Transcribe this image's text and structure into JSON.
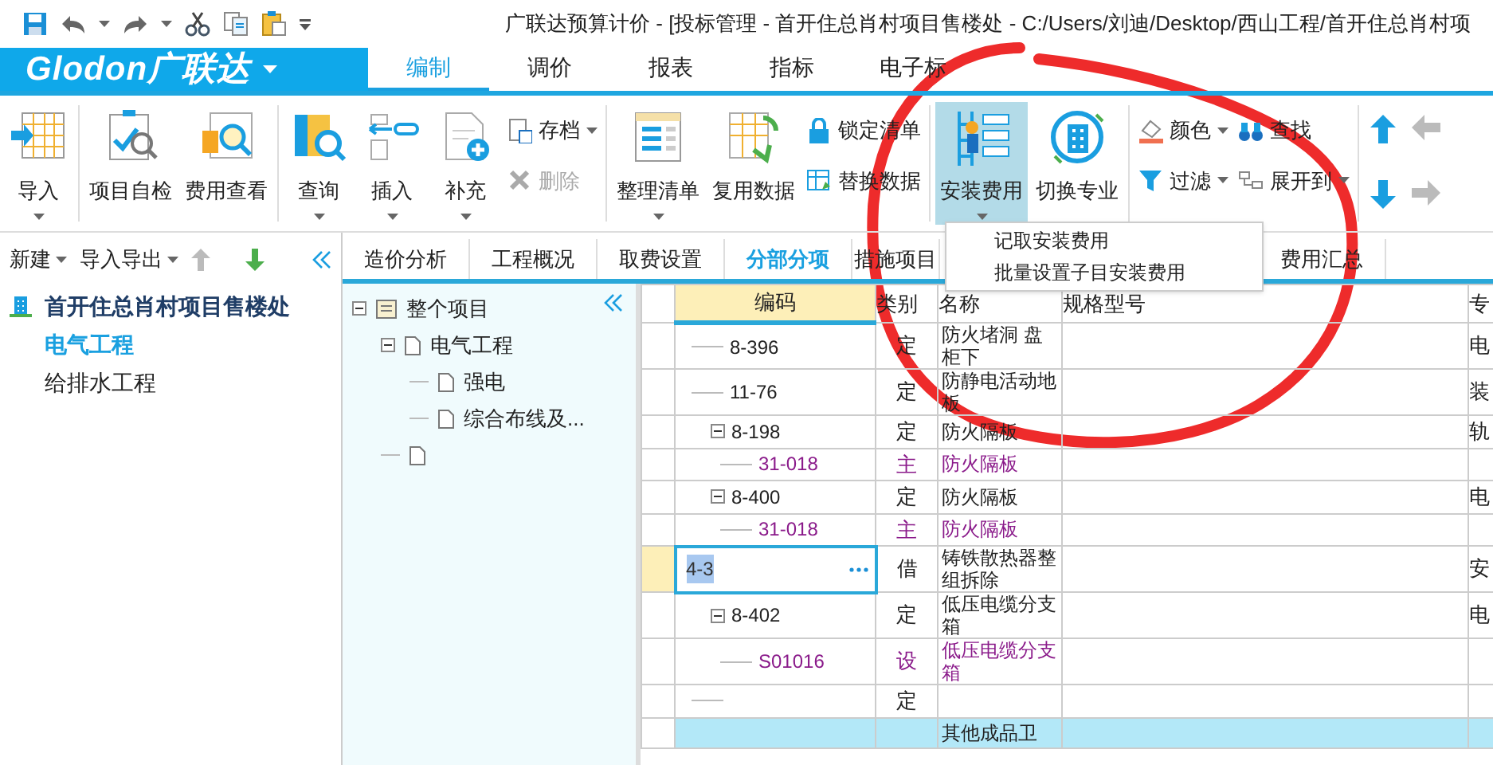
{
  "window": {
    "title": "广联达预算计价 - [投标管理 - 首开住总肖村项目售楼处 - C:/Users/刘迪/Desktop/西山工程/首开住总肖村项"
  },
  "logo": "Glodon广联达",
  "menu_tabs": [
    {
      "label": "编制",
      "selected": true
    },
    {
      "label": "调价",
      "selected": false
    },
    {
      "label": "报表",
      "selected": false
    },
    {
      "label": "指标",
      "selected": false
    },
    {
      "label": "电子标",
      "selected": false
    }
  ],
  "ribbon": [
    [
      {
        "kind": "large",
        "label": "导入",
        "dropdown": true,
        "pressed": false
      }
    ],
    [
      {
        "kind": "large",
        "label": "项目自检",
        "dropdown": false,
        "pressed": false
      },
      {
        "kind": "large",
        "label": "费用查看",
        "dropdown": false,
        "pressed": false
      }
    ],
    [
      {
        "kind": "large",
        "label": "查询",
        "dropdown": true,
        "pressed": false
      },
      {
        "kind": "large",
        "label": "插入",
        "dropdown": true,
        "pressed": false
      },
      {
        "kind": "large",
        "label": "补充",
        "dropdown": true,
        "pressed": false
      },
      {
        "kind": "column",
        "items": [
          {
            "label": "存档",
            "dropdown": true,
            "disabled": false
          },
          {
            "label": "删除",
            "dropdown": false,
            "disabled": true
          }
        ]
      }
    ],
    [
      {
        "kind": "large",
        "label": "整理清单",
        "dropdown": true,
        "pressed": false
      },
      {
        "kind": "large",
        "label": "复用数据",
        "dropdown": false,
        "pressed": false
      },
      {
        "kind": "column",
        "items": [
          {
            "label": "锁定清单",
            "dropdown": false,
            "disabled": false
          },
          {
            "label": "替换数据",
            "dropdown": false,
            "disabled": false
          }
        ]
      }
    ],
    [
      {
        "kind": "large",
        "label": "安装费用",
        "dropdown": true,
        "pressed": true
      },
      {
        "kind": "large",
        "label": "切换专业",
        "dropdown": false,
        "pressed": false
      }
    ],
    [
      {
        "kind": "column",
        "items": [
          {
            "label": "颜色",
            "dropdown": true,
            "disabled": false
          },
          {
            "label": "过滤",
            "dropdown": true,
            "disabled": false
          }
        ]
      },
      {
        "kind": "column",
        "items": [
          {
            "label": "查找",
            "dropdown": false,
            "disabled": false
          },
          {
            "label": "展开到",
            "dropdown": true,
            "disabled": false
          }
        ]
      }
    ],
    [
      {
        "kind": "arrows"
      }
    ]
  ],
  "left_panel": {
    "toolbar": [
      {
        "label": "新建",
        "dropdown": true
      },
      {
        "label": "导入导出",
        "dropdown": true
      }
    ],
    "project": {
      "name": "首开住总肖村项目售楼处",
      "children": [
        {
          "name": "电气工程",
          "selected": true
        },
        {
          "name": "给排水工程",
          "selected": false
        }
      ]
    }
  },
  "tabs": [
    {
      "label": "造价分析",
      "selected": false
    },
    {
      "label": "工程概况",
      "selected": false
    },
    {
      "label": "取费设置",
      "selected": false
    },
    {
      "label": "分部分项",
      "selected": true
    },
    {
      "label": "措施项目",
      "selected": false
    },
    {
      "label": "费用汇总",
      "selected": false
    }
  ],
  "dropdown_menu": {
    "items": [
      "记取安装费用",
      "批量设置子目安装费用"
    ]
  },
  "subtree": [
    {
      "kind": "form",
      "label": "整个项目",
      "expanded": true,
      "children": [
        {
          "kind": "document",
          "label": "电气工程",
          "expanded": true,
          "children": [
            {
              "kind": "document",
              "label": "强电"
            },
            {
              "kind": "document",
              "label": "综合布线及..."
            }
          ]
        },
        {
          "kind": "document"
        }
      ]
    }
  ],
  "grid": {
    "columns": [
      {
        "label": "编码",
        "selected": true
      },
      {
        "label": "类别",
        "selected": false
      },
      {
        "label": "名称",
        "selected": false
      },
      {
        "label": "规格型号",
        "selected": false
      },
      {
        "label": "专",
        "selected": false
      }
    ],
    "rows": [
      {
        "kind": "quota",
        "code": "8-396",
        "category": "定",
        "name": "防火堵洞 盘柜下",
        "column_5": "电",
        "selected": false,
        "highlighted": false
      },
      {
        "kind": "quota",
        "code": "11-76",
        "category": "定",
        "name": "防静电活动地板",
        "column_5": "装",
        "selected": false,
        "highlighted": false
      },
      {
        "kind": "quota",
        "code": "8-198",
        "category": "定",
        "name": "防火隔板",
        "column_5": "轨",
        "selected": false,
        "highlighted": false,
        "children": [
          {
            "kind": "material",
            "code": "31-018",
            "category": "主",
            "name": "防火隔板",
            "selected": false,
            "highlighted": false
          }
        ]
      },
      {
        "kind": "quota",
        "code": "8-400",
        "category": "定",
        "name": "防火隔板",
        "column_5": "电",
        "selected": false,
        "highlighted": false,
        "children": [
          {
            "kind": "material",
            "code": "31-018",
            "category": "主",
            "name": "防火隔板",
            "selected": false,
            "highlighted": false
          }
        ]
      },
      {
        "kind": "quota",
        "code": "4-3",
        "category": "借",
        "name": "铸铁散热器整组拆除",
        "column_5": "安",
        "selected": true,
        "highlighted": false
      },
      {
        "kind": "quota",
        "code": "8-402",
        "category": "定",
        "name": "低压电缆分支箱",
        "column_5": "电",
        "selected": false,
        "highlighted": false,
        "children": [
          {
            "kind": "material",
            "code": "S01016",
            "category": "设",
            "name": "低压电缆分支箱",
            "selected": false,
            "highlighted": false
          }
        ]
      },
      {
        "kind": "quota",
        "category": "定",
        "selected": false,
        "highlighted": false
      },
      {
        "kind": "section",
        "name": "其他成品卫",
        "selected": false,
        "highlighted": true
      }
    ]
  }
}
